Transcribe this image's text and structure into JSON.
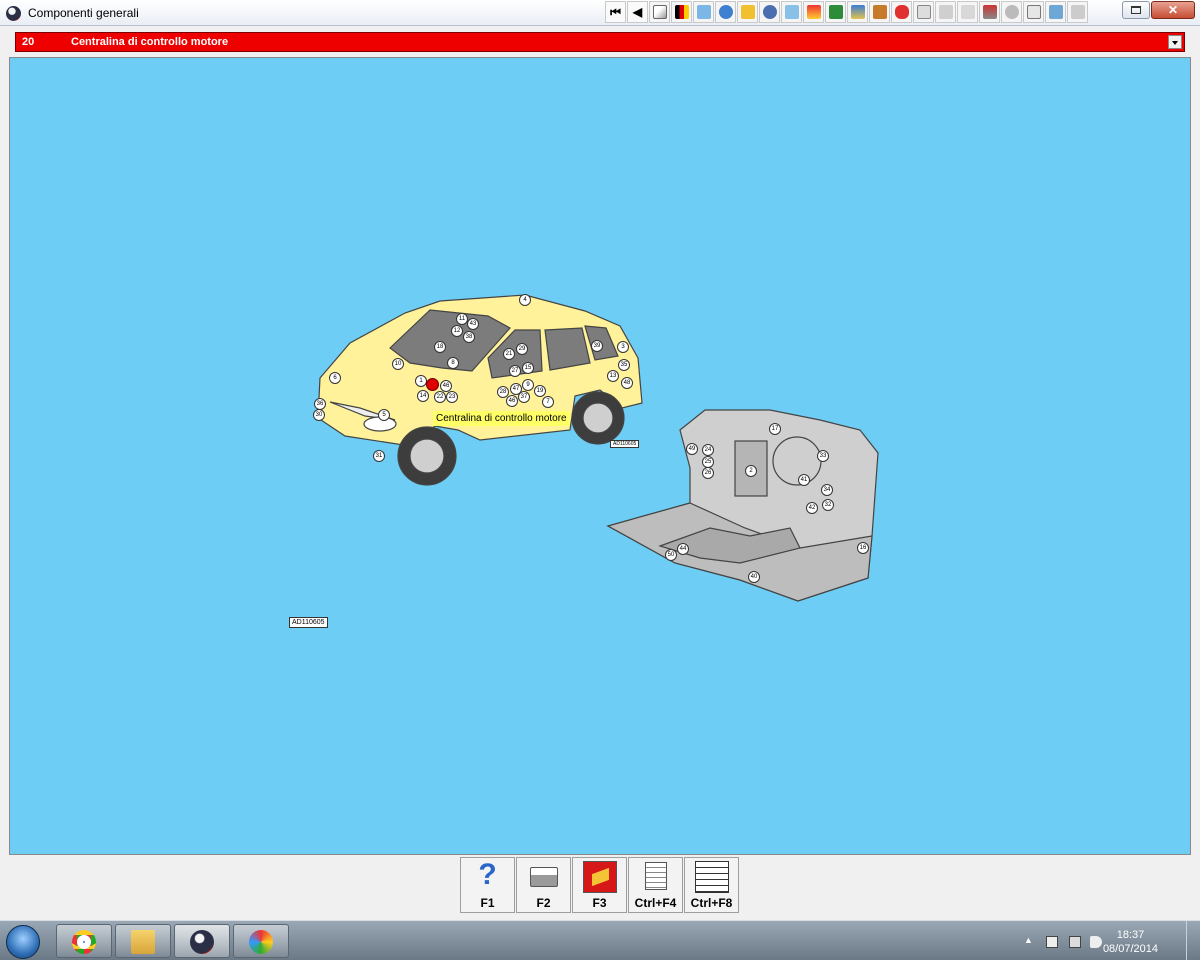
{
  "window": {
    "title": "Componenti generali"
  },
  "toolbar": {
    "icons": [
      "first-icon",
      "prev-icon",
      "warning-icon",
      "flag-icon",
      "diagram-icon",
      "gear-icon",
      "tools-icon",
      "clock-icon",
      "spanner-icon",
      "ramp-icon",
      "lift-icon",
      "engine-icon",
      "book-icon",
      "car-icon",
      "component-icon",
      "print-icon",
      "car-info-icon",
      "fault-icon",
      "location-icon",
      "hazard-icon",
      "exchange-icon",
      "wiring-icon"
    ]
  },
  "selector": {
    "number": "20",
    "label": "Centralina di controllo motore"
  },
  "diagram": {
    "tooltip": "Centralina di controllo motore",
    "figure_ref": "AD110605",
    "small_ref": "AD110605",
    "car_callouts": [
      "4",
      "11",
      "12",
      "43",
      "38",
      "18",
      "8",
      "10",
      "6",
      "1",
      "46",
      "14",
      "22",
      "23",
      "5",
      "36",
      "30",
      "31",
      "21",
      "29",
      "15",
      "27",
      "28",
      "47",
      "9",
      "19",
      "37",
      "46",
      "7",
      "39",
      "3",
      "35",
      "13",
      "48"
    ],
    "dash_callouts": [
      "17",
      "49",
      "24",
      "25",
      "26",
      "2",
      "33",
      "41",
      "34",
      "32",
      "42",
      "44",
      "50",
      "40",
      "16"
    ]
  },
  "function_keys": [
    {
      "key": "F1",
      "icon": "help-icon"
    },
    {
      "key": "F2",
      "icon": "print-icon"
    },
    {
      "key": "F3",
      "icon": "component-icon"
    },
    {
      "key": "Ctrl+F4",
      "icon": "notes-icon"
    },
    {
      "key": "Ctrl+F8",
      "icon": "list-icon"
    }
  ],
  "taskbar": {
    "apps": [
      "chrome-icon",
      "explorer-icon",
      "diagnostic-app-icon",
      "paint-icon"
    ],
    "time": "18:37",
    "date": "08/07/2014"
  }
}
